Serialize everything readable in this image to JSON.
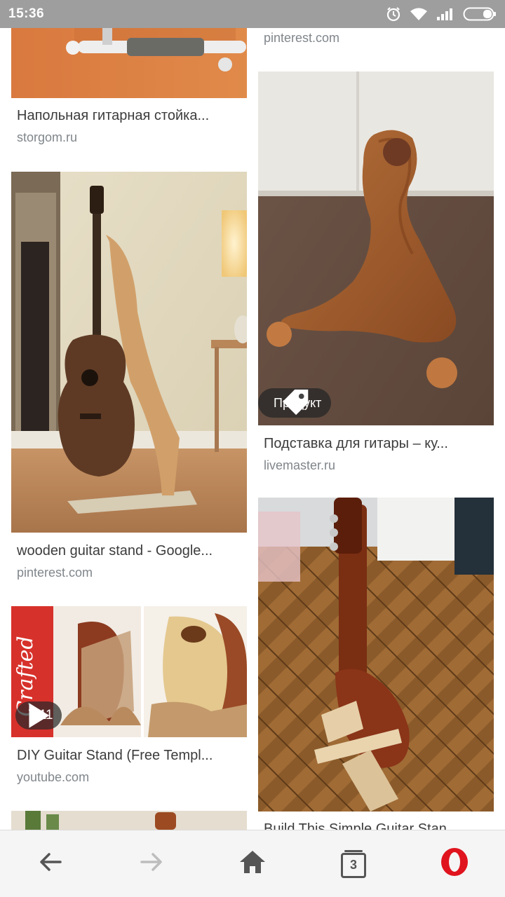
{
  "status_bar": {
    "time": "15:36"
  },
  "results": [
    {
      "caption": "Напольная гитарная стойка...",
      "source": "storgom.ru"
    },
    {
      "caption": "wooden guitar stand - Google...",
      "source": "pinterest.com"
    },
    {
      "caption": "DIY Guitar Stand (Free Templ...",
      "source": "youtube.com",
      "video_duration": "7:11"
    },
    {
      "source": "pinterest.com"
    },
    {
      "caption": "Подставка для гитары – ку...",
      "source": "livemaster.ru",
      "badge": "Продукт"
    },
    {
      "caption": "Build This Simple Guitar Stan..."
    }
  ],
  "bottom_nav": {
    "tab_count": "3",
    "buttons": [
      "back-icon",
      "forward-icon",
      "home-icon",
      "tabs-icon",
      "opera-icon"
    ]
  },
  "colors": {
    "status_bar": "#9e9e9e",
    "opera_red": "#e0141e",
    "source_text": "#80868b"
  }
}
